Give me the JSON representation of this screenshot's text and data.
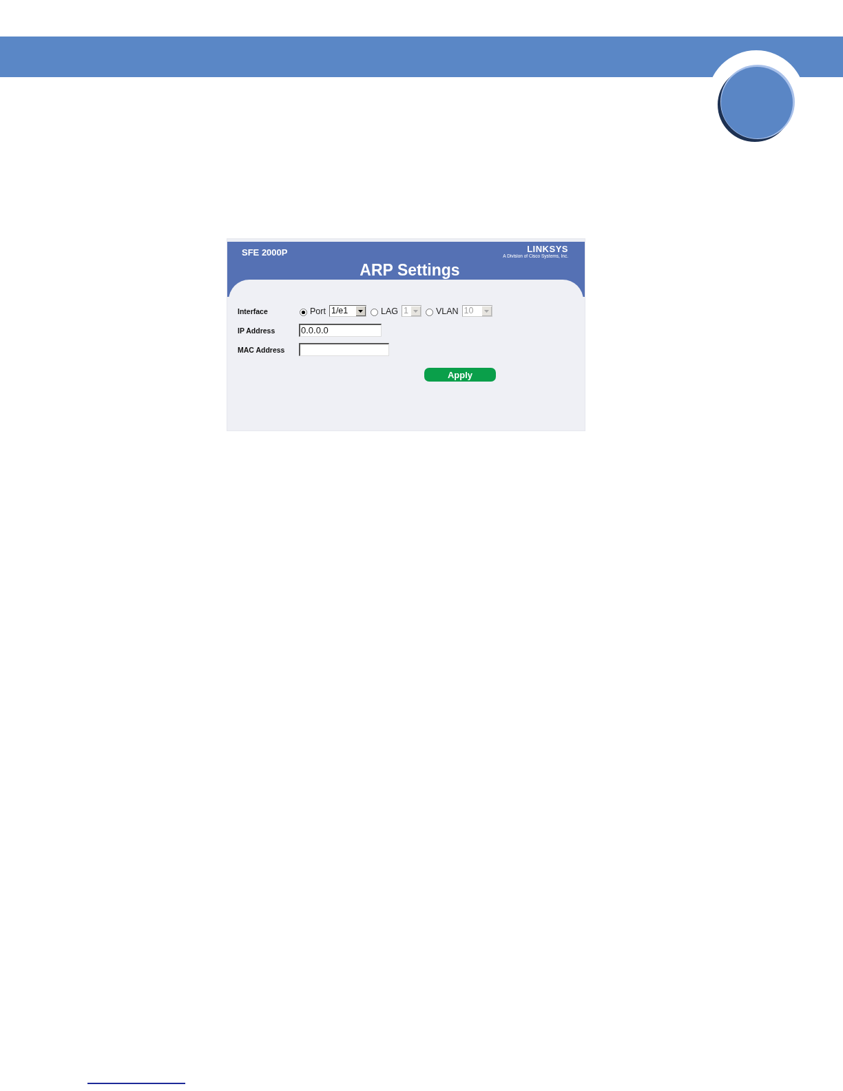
{
  "screenshot": {
    "model": "SFE 2000P",
    "brand": "LINKSYS",
    "brand_tagline": "A Division of Cisco Systems, Inc.",
    "title": "ARP Settings",
    "interface": {
      "label": "Interface",
      "options": [
        {
          "label": "Port",
          "selected": true,
          "value": "1/e1",
          "disabled": false
        },
        {
          "label": "LAG",
          "selected": false,
          "value": "1",
          "disabled": true
        },
        {
          "label": "VLAN",
          "selected": false,
          "value": "10",
          "disabled": true
        }
      ]
    },
    "fields": [
      {
        "label": "IP Address",
        "value": "0.0.0.0"
      },
      {
        "label": "MAC Address"
      }
    ],
    "apply_button": {
      "label": "Apply"
    }
  }
}
